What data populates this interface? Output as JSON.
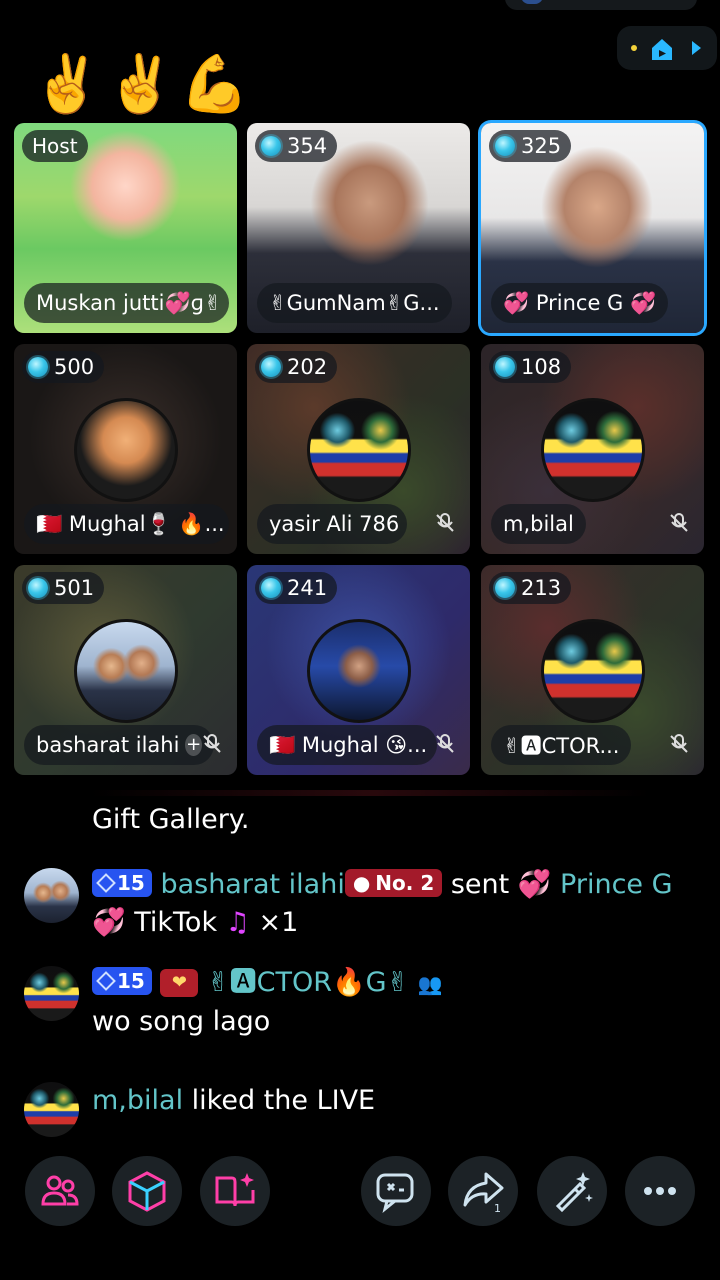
{
  "emoji_row": "✌️✌️💪",
  "tiles": [
    {
      "badge": "Host",
      "name": "Muskan jutti💞ɡ✌"
    },
    {
      "badge": "354",
      "name": "✌GumNam✌G..."
    },
    {
      "badge": "325",
      "name": "💞 Prince G 💞"
    },
    {
      "badge": "500",
      "name": "🇧🇭 Mughal🍷 🔥..."
    },
    {
      "badge": "202",
      "name": "yasir Ali 786"
    },
    {
      "badge": "108",
      "name": "m,bilal"
    },
    {
      "badge": "501",
      "name": "basharat ilahi",
      "action": "+"
    },
    {
      "badge": "241",
      "name": "🇧🇭 Mughal 😘..."
    },
    {
      "badge": "213",
      "name": "✌🅰CTOR..."
    }
  ],
  "feed": {
    "gift_gallery": "Gift Gallery.",
    "msg1": {
      "level": "15",
      "user": "basharat ilahi",
      "rank": "No. 2",
      "verb": "sent",
      "target": "Prince G",
      "gift": "TikTok",
      "count": "×1"
    },
    "msg2": {
      "level": "15",
      "user": "✌🅰CTOR🔥G✌",
      "text": "wo song lago"
    },
    "msg3": {
      "user": "m,bilal",
      "text": "liked the LIVE"
    }
  },
  "bottom_icons": [
    "people-icon",
    "box-icon",
    "book-icon",
    "chat-icon",
    "share-icon",
    "magic-wand-icon",
    "more-icon"
  ],
  "share_count": "1",
  "colors": {
    "accent_pink": "#ff3fa8",
    "accent_blue": "#2aa8ff",
    "teal_name": "#63c5c9"
  }
}
